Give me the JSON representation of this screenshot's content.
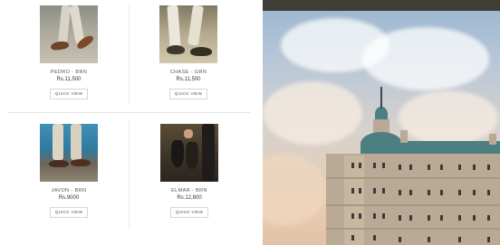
{
  "products": [
    {
      "name": "PEDRO - BRN",
      "price": "Rs.11,500",
      "quick_view": "QUICK VIEW",
      "image": "brown-loafers-photo"
    },
    {
      "name": "CHASE - GRN",
      "price": "Rs.11,500",
      "quick_view": "QUICK VIEW",
      "image": "green-suede-shoes-photo"
    },
    {
      "name": "JAVON - BRN",
      "price": "Rs.9000",
      "quick_view": "QUICK VIEW",
      "image": "brown-sandals-poolside-photo"
    },
    {
      "name": "ELMAR - BRN",
      "price": "Rs.12,800",
      "quick_view": "QUICK VIEW",
      "image": "dark-boots-in-hand-photo"
    }
  ],
  "hero": {
    "image": "historic-building-at-sunset-photo"
  },
  "colors": {
    "divider": "#ececec",
    "text": "#555555",
    "button_border": "#d6d6d6"
  }
}
